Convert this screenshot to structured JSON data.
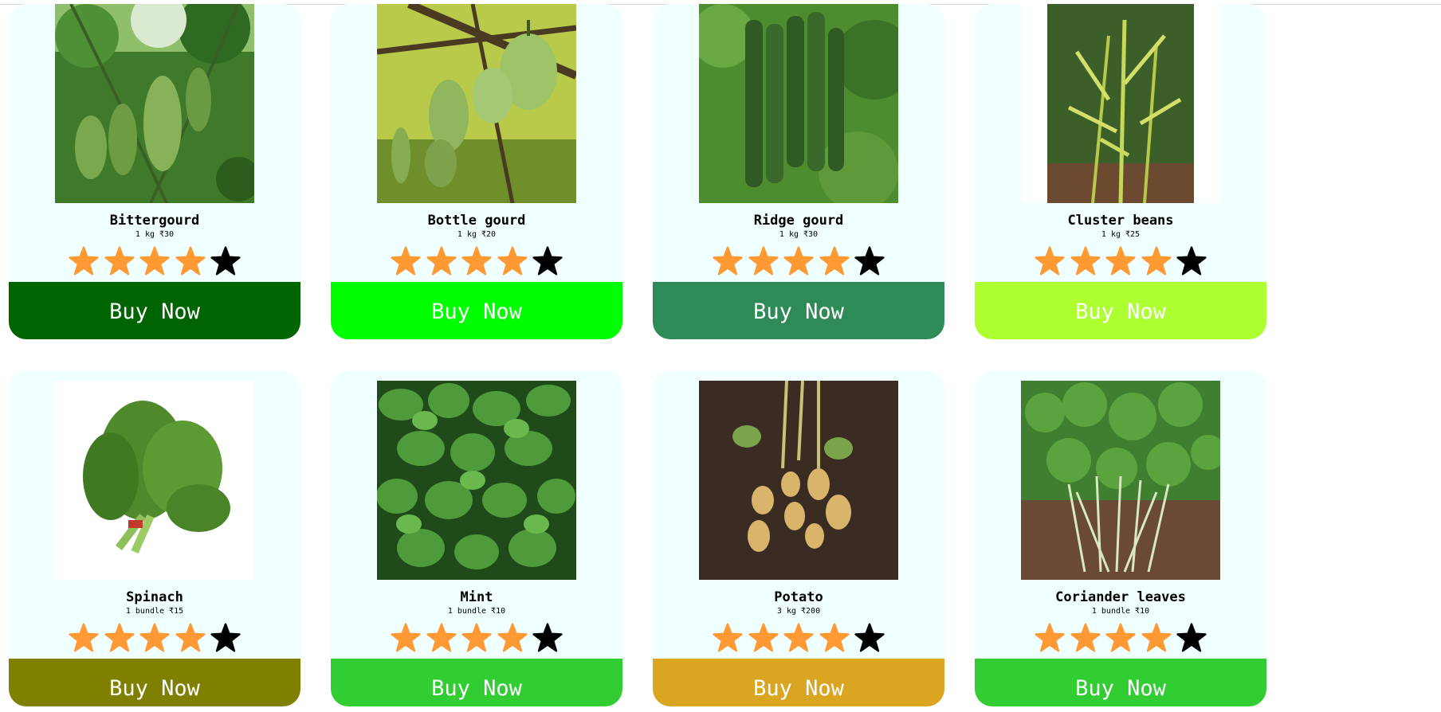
{
  "products": [
    {
      "name": "Bittergourd",
      "qty": "1 kg ₹30",
      "rating": 4,
      "max_rating": 5,
      "button_label": "Buy Now",
      "button_color": "#006400",
      "image": "bittergourd-vines"
    },
    {
      "name": "Bottle gourd",
      "qty": "1 kg ₹20",
      "rating": 4,
      "max_rating": 5,
      "button_label": "Buy Now",
      "button_color": "#00ff00",
      "image": "bottle-gourd-hanging"
    },
    {
      "name": "Ridge gourd",
      "qty": "1 kg ₹30",
      "rating": 4,
      "max_rating": 5,
      "button_label": "Buy Now",
      "button_color": "#2e8b57",
      "image": "ridge-gourd-hanging"
    },
    {
      "name": "Cluster beans",
      "qty": "1 kg ₹25",
      "rating": 4,
      "max_rating": 5,
      "button_label": "Buy Now",
      "button_color": "#adff2f",
      "image": "cluster-beans-plant"
    },
    {
      "name": "Spinach",
      "qty": "1 bundle ₹15",
      "rating": 4,
      "max_rating": 5,
      "button_label": "Buy Now",
      "button_color": "#808000",
      "image": "spinach-bundle"
    },
    {
      "name": "Mint",
      "qty": "1 bundle ₹10",
      "rating": 4,
      "max_rating": 5,
      "button_label": "Buy Now",
      "button_color": "#32cd32",
      "image": "mint-leaves"
    },
    {
      "name": "Potato",
      "qty": "3 kg ₹200",
      "rating": 4,
      "max_rating": 5,
      "button_label": "Buy Now",
      "button_color": "#daa520",
      "image": "potatoes-in-soil"
    },
    {
      "name": "Coriander leaves",
      "qty": "1 bundle ₹10",
      "rating": 4,
      "max_rating": 5,
      "button_label": "Buy Now",
      "button_color": "#32cd32",
      "image": "coriander-plants"
    }
  ],
  "colors": {
    "card_background": "#f0ffff",
    "star_filled": "#ff9933",
    "star_empty": "#000000"
  }
}
